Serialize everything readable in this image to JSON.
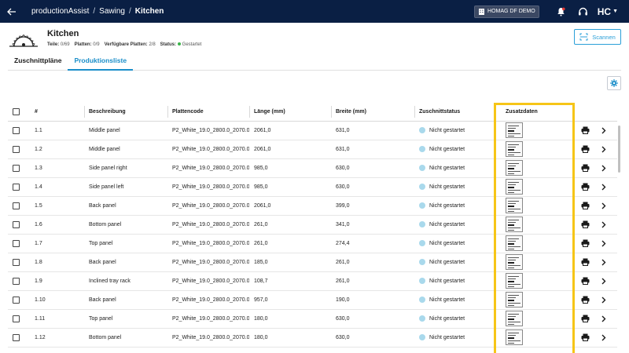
{
  "topbar": {
    "breadcrumb": [
      "productionAssist",
      "Sawing",
      "Kitchen"
    ],
    "separator": "/",
    "tenant_label": "HOMAG DF DEMO",
    "brand": "HC"
  },
  "header": {
    "title": "Kitchen",
    "meta": {
      "parts_label": "Teile:",
      "parts_value": "0/69",
      "boards_label": "Platten:",
      "boards_value": "0/9",
      "available_label": "Verfügbare Platten:",
      "available_value": "2/8",
      "status_label": "Status:",
      "status_value": "Gestartet"
    },
    "scan_button": "Scannen"
  },
  "tabs": [
    {
      "label": "Zuschnittpläne",
      "active": false
    },
    {
      "label": "Produktionsliste",
      "active": true
    }
  ],
  "table": {
    "columns": [
      "#",
      "Beschreibung",
      "Plattencode",
      "Länge (mm)",
      "Breite (mm)",
      "Zuschnittstatus",
      "Zusatzdaten"
    ],
    "rows": [
      {
        "id": "1.1",
        "desc": "Middle panel",
        "code": "P2_White_19.0_2800.0_2070.0",
        "length": "2061,0",
        "width": "631,0",
        "status": "Nicht gestartet"
      },
      {
        "id": "1.2",
        "desc": "Middle panel",
        "code": "P2_White_19.0_2800.0_2070.0",
        "length": "2061,0",
        "width": "631,0",
        "status": "Nicht gestartet"
      },
      {
        "id": "1.3",
        "desc": "Side panel right",
        "code": "P2_White_19.0_2800.0_2070.0",
        "length": "985,0",
        "width": "630,0",
        "status": "Nicht gestartet"
      },
      {
        "id": "1.4",
        "desc": "Side panel left",
        "code": "P2_White_19.0_2800.0_2070.0",
        "length": "985,0",
        "width": "630,0",
        "status": "Nicht gestartet"
      },
      {
        "id": "1.5",
        "desc": "Back panel",
        "code": "P2_White_19.0_2800.0_2070.0",
        "length": "2061,0",
        "width": "399,0",
        "status": "Nicht gestartet"
      },
      {
        "id": "1.6",
        "desc": "Bottom panel",
        "code": "P2_White_19.0_2800.0_2070.0",
        "length": "261,0",
        "width": "341,0",
        "status": "Nicht gestartet"
      },
      {
        "id": "1.7",
        "desc": "Top panel",
        "code": "P2_White_19.0_2800.0_2070.0",
        "length": "261,0",
        "width": "274,4",
        "status": "Nicht gestartet"
      },
      {
        "id": "1.8",
        "desc": "Back panel",
        "code": "P2_White_19.0_2800.0_2070.0",
        "length": "185,0",
        "width": "261,0",
        "status": "Nicht gestartet"
      },
      {
        "id": "1.9",
        "desc": "Inclined tray rack",
        "code": "P2_White_19.0_2800.0_2070.0",
        "length": "108,7",
        "width": "261,0",
        "status": "Nicht gestartet"
      },
      {
        "id": "1.10",
        "desc": "Back panel",
        "code": "P2_White_19.0_2800.0_2070.0",
        "length": "957,0",
        "width": "190,0",
        "status": "Nicht gestartet"
      },
      {
        "id": "1.11",
        "desc": "Top panel",
        "code": "P2_White_19.0_2800.0_2070.0",
        "length": "180,0",
        "width": "630,0",
        "status": "Nicht gestartet"
      },
      {
        "id": "1.12",
        "desc": "Bottom panel",
        "code": "P2_White_19.0_2800.0_2070.0",
        "length": "180,0",
        "width": "630,0",
        "status": "Nicht gestartet"
      }
    ]
  },
  "colors": {
    "topbar_bg": "#0a1f44",
    "accent": "#1a8ec9",
    "status_dot": "#a9d9ec",
    "highlight": "#f6c517"
  },
  "icons": [
    "back-arrow-icon",
    "building-icon",
    "bell-icon",
    "support-icon",
    "saw-blade-icon",
    "scan-icon",
    "gear-icon",
    "print-icon",
    "chevron-right-icon"
  ]
}
